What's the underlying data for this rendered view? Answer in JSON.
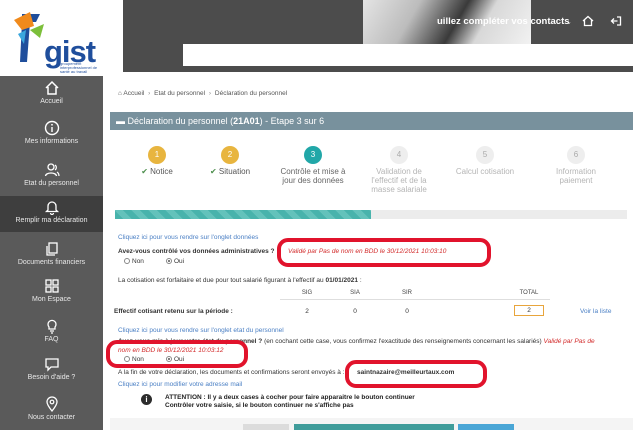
{
  "logo": {
    "word": "gist",
    "subtitle": "groupement interprofessionnel de santé au travail"
  },
  "sidebar": {
    "items": [
      {
        "label": "Accueil",
        "icon": "home-icon"
      },
      {
        "label": "Mes informations",
        "icon": "info-icon"
      },
      {
        "label": "Etat du personnel",
        "icon": "people-icon"
      },
      {
        "label": "Remplir ma déclaration",
        "icon": "bell-icon",
        "active": true
      },
      {
        "label": "Documents financiers",
        "icon": "documents-icon"
      },
      {
        "label": "Mon Espace",
        "icon": "grid-icon"
      },
      {
        "label": "FAQ",
        "icon": "lightbulb-icon"
      },
      {
        "label": "Besoin d'aide ?",
        "icon": "chat-icon"
      },
      {
        "label": "Nous contacter",
        "icon": "location-icon"
      }
    ]
  },
  "header": {
    "title": "uillez compléter vos contacts",
    "caret": "⌄"
  },
  "breadcrumb": {
    "home": "Accueil",
    "section": "Etat du personnel",
    "page": "Déclaration du personnel"
  },
  "panel": {
    "title_prefix": "Déclaration du personnel (",
    "code": "21A01",
    "title_suffix": ") - Etape 3 sur 6"
  },
  "steps": [
    {
      "number": "1",
      "label": "Notice",
      "status": "done"
    },
    {
      "number": "2",
      "label": "Situation",
      "status": "done"
    },
    {
      "number": "3",
      "label": "Contrôle et mise à jour des données",
      "status": "current"
    },
    {
      "number": "4",
      "label": "Validation de l'effectif et de la masse salariale",
      "status": "todo"
    },
    {
      "number": "5",
      "label": "Calcul cotisation",
      "status": "todo"
    },
    {
      "number": "6",
      "label": "Information paiement",
      "status": "todo"
    }
  ],
  "progress": {
    "fraction": 0.5
  },
  "section1": {
    "link": "Cliquez ici pour vous rendre sur l'onglet données",
    "question": "Avez-vous contrôlé vos données administratives ?",
    "validated": "Validé par Pas de nom en BDD le 30/12/2021 10:03:10",
    "radio_no": "Non",
    "radio_yes": "Oui"
  },
  "cotisation": {
    "text_before": "La cotisation est forfaitaire et due pour tout salarié figurant à l'effectif au",
    "date": "01/01/2021",
    "text_after": ":"
  },
  "effectif": {
    "label": "Effectif cotisant retenu sur la période :",
    "headers": [
      "SIG",
      "SIA",
      "SIR",
      "TOTAL"
    ],
    "values": [
      "2",
      "0",
      "0",
      "2"
    ],
    "link": "Voir la liste"
  },
  "section2": {
    "link": "Cliquez ici pour vous rendre sur l'onglet etat du personnel",
    "question": "Avez-vous mis à jour votre état du personnel ?",
    "explain": "(en cochant cette case, vous confirmez l'exactitude des renseignements concernant les salariés)",
    "validated_a": "Validé par Pas de",
    "validated_b": "nom en BDD le 30/12/2021 10:03:12",
    "radio_no": "Non",
    "radio_yes": "Oui"
  },
  "email": {
    "text": "A la fin de votre déclaration, les documents et confirmations seront envoyés à :",
    "address": "saintnazaire@meilleurtaux.com",
    "link": "Cliquez ici pour modifier votre adresse mail"
  },
  "attention": {
    "icon": "info-circle-icon",
    "line1": "ATTENTION : Il y a deux cases à cocher pour faire apparaitre le bouton continuer",
    "line2": "Contrôler votre saisie, si le bouton continuer ne s'affiche pas"
  },
  "colors": {
    "sidebar": "#5a5a5a",
    "panel": "#78919d",
    "accent_teal": "#21a7a8",
    "step_done": "#e8b53f",
    "callout": "#e1132c",
    "link": "#4a7fc4"
  }
}
